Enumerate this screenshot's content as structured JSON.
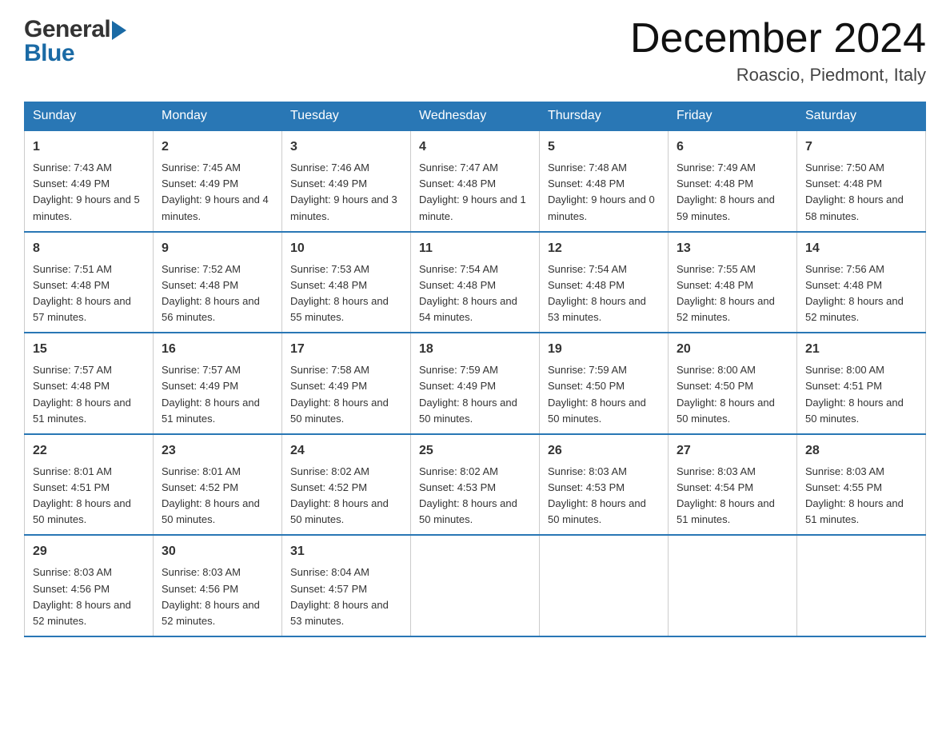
{
  "header": {
    "title": "December 2024",
    "subtitle": "Roascio, Piedmont, Italy",
    "logo_line1": "General",
    "logo_line2": "Blue"
  },
  "days_of_week": [
    "Sunday",
    "Monday",
    "Tuesday",
    "Wednesday",
    "Thursday",
    "Friday",
    "Saturday"
  ],
  "weeks": [
    [
      {
        "day": "1",
        "sunrise": "7:43 AM",
        "sunset": "4:49 PM",
        "daylight": "9 hours and 5 minutes."
      },
      {
        "day": "2",
        "sunrise": "7:45 AM",
        "sunset": "4:49 PM",
        "daylight": "9 hours and 4 minutes."
      },
      {
        "day": "3",
        "sunrise": "7:46 AM",
        "sunset": "4:49 PM",
        "daylight": "9 hours and 3 minutes."
      },
      {
        "day": "4",
        "sunrise": "7:47 AM",
        "sunset": "4:48 PM",
        "daylight": "9 hours and 1 minute."
      },
      {
        "day": "5",
        "sunrise": "7:48 AM",
        "sunset": "4:48 PM",
        "daylight": "9 hours and 0 minutes."
      },
      {
        "day": "6",
        "sunrise": "7:49 AM",
        "sunset": "4:48 PM",
        "daylight": "8 hours and 59 minutes."
      },
      {
        "day": "7",
        "sunrise": "7:50 AM",
        "sunset": "4:48 PM",
        "daylight": "8 hours and 58 minutes."
      }
    ],
    [
      {
        "day": "8",
        "sunrise": "7:51 AM",
        "sunset": "4:48 PM",
        "daylight": "8 hours and 57 minutes."
      },
      {
        "day": "9",
        "sunrise": "7:52 AM",
        "sunset": "4:48 PM",
        "daylight": "8 hours and 56 minutes."
      },
      {
        "day": "10",
        "sunrise": "7:53 AM",
        "sunset": "4:48 PM",
        "daylight": "8 hours and 55 minutes."
      },
      {
        "day": "11",
        "sunrise": "7:54 AM",
        "sunset": "4:48 PM",
        "daylight": "8 hours and 54 minutes."
      },
      {
        "day": "12",
        "sunrise": "7:54 AM",
        "sunset": "4:48 PM",
        "daylight": "8 hours and 53 minutes."
      },
      {
        "day": "13",
        "sunrise": "7:55 AM",
        "sunset": "4:48 PM",
        "daylight": "8 hours and 52 minutes."
      },
      {
        "day": "14",
        "sunrise": "7:56 AM",
        "sunset": "4:48 PM",
        "daylight": "8 hours and 52 minutes."
      }
    ],
    [
      {
        "day": "15",
        "sunrise": "7:57 AM",
        "sunset": "4:48 PM",
        "daylight": "8 hours and 51 minutes."
      },
      {
        "day": "16",
        "sunrise": "7:57 AM",
        "sunset": "4:49 PM",
        "daylight": "8 hours and 51 minutes."
      },
      {
        "day": "17",
        "sunrise": "7:58 AM",
        "sunset": "4:49 PM",
        "daylight": "8 hours and 50 minutes."
      },
      {
        "day": "18",
        "sunrise": "7:59 AM",
        "sunset": "4:49 PM",
        "daylight": "8 hours and 50 minutes."
      },
      {
        "day": "19",
        "sunrise": "7:59 AM",
        "sunset": "4:50 PM",
        "daylight": "8 hours and 50 minutes."
      },
      {
        "day": "20",
        "sunrise": "8:00 AM",
        "sunset": "4:50 PM",
        "daylight": "8 hours and 50 minutes."
      },
      {
        "day": "21",
        "sunrise": "8:00 AM",
        "sunset": "4:51 PM",
        "daylight": "8 hours and 50 minutes."
      }
    ],
    [
      {
        "day": "22",
        "sunrise": "8:01 AM",
        "sunset": "4:51 PM",
        "daylight": "8 hours and 50 minutes."
      },
      {
        "day": "23",
        "sunrise": "8:01 AM",
        "sunset": "4:52 PM",
        "daylight": "8 hours and 50 minutes."
      },
      {
        "day": "24",
        "sunrise": "8:02 AM",
        "sunset": "4:52 PM",
        "daylight": "8 hours and 50 minutes."
      },
      {
        "day": "25",
        "sunrise": "8:02 AM",
        "sunset": "4:53 PM",
        "daylight": "8 hours and 50 minutes."
      },
      {
        "day": "26",
        "sunrise": "8:03 AM",
        "sunset": "4:53 PM",
        "daylight": "8 hours and 50 minutes."
      },
      {
        "day": "27",
        "sunrise": "8:03 AM",
        "sunset": "4:54 PM",
        "daylight": "8 hours and 51 minutes."
      },
      {
        "day": "28",
        "sunrise": "8:03 AM",
        "sunset": "4:55 PM",
        "daylight": "8 hours and 51 minutes."
      }
    ],
    [
      {
        "day": "29",
        "sunrise": "8:03 AM",
        "sunset": "4:56 PM",
        "daylight": "8 hours and 52 minutes."
      },
      {
        "day": "30",
        "sunrise": "8:03 AM",
        "sunset": "4:56 PM",
        "daylight": "8 hours and 52 minutes."
      },
      {
        "day": "31",
        "sunrise": "8:04 AM",
        "sunset": "4:57 PM",
        "daylight": "8 hours and 53 minutes."
      },
      null,
      null,
      null,
      null
    ]
  ]
}
